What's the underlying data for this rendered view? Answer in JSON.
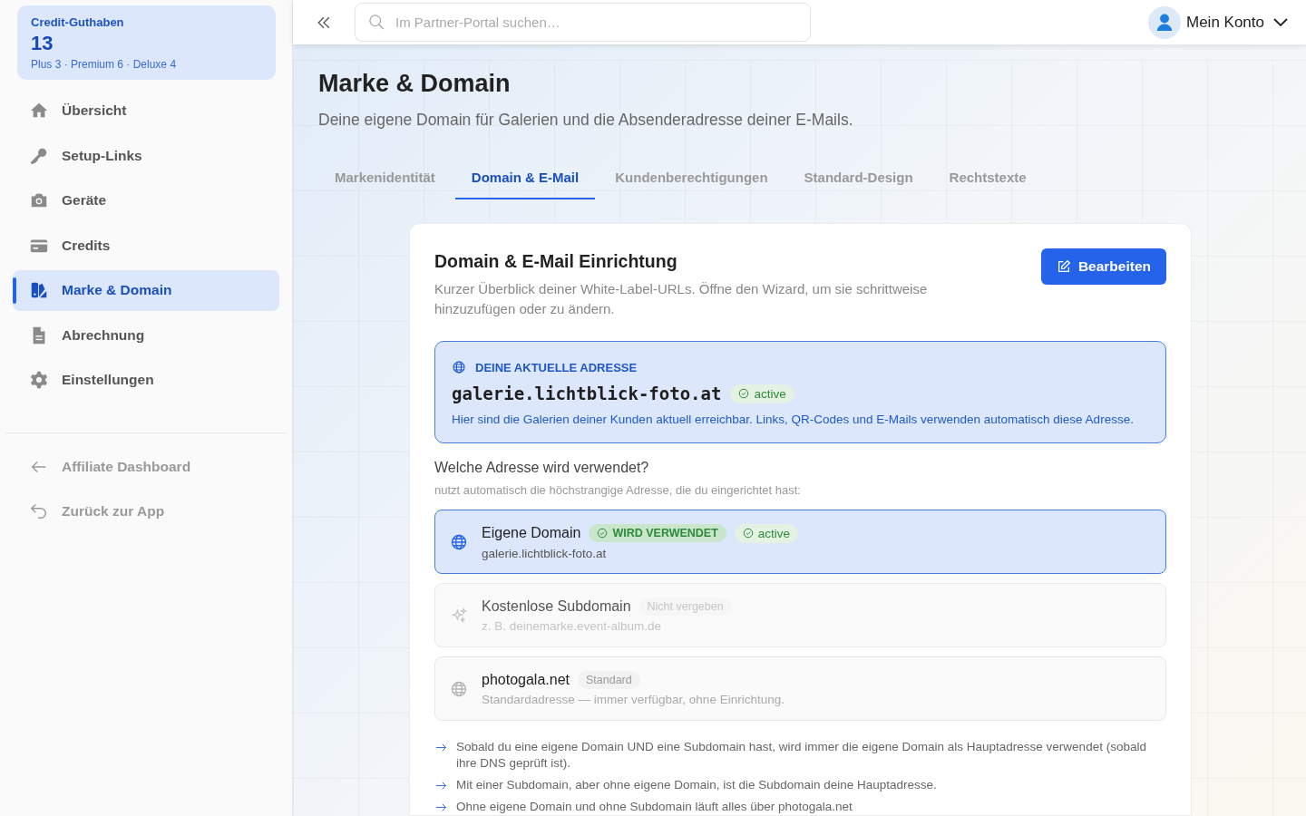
{
  "credit": {
    "label": "Credit-Guthaben",
    "value": "13",
    "breakdown": "Plus 3 · Premium 6 · Deluxe 4"
  },
  "nav": [
    {
      "kind": "home",
      "label": "Übersicht",
      "selected": false
    },
    {
      "kind": "key",
      "label": "Setup-Links",
      "selected": false
    },
    {
      "kind": "camera",
      "label": "Geräte",
      "selected": false
    },
    {
      "kind": "card",
      "label": "Credits",
      "selected": false
    },
    {
      "kind": "brand",
      "label": "Marke & Domain",
      "selected": true
    },
    {
      "kind": "doc",
      "label": "Abrechnung",
      "selected": false
    },
    {
      "kind": "gear",
      "label": "Einstellungen",
      "selected": false
    }
  ],
  "nav_secondary": [
    {
      "kind": "arrow",
      "label": "Affiliate Dashboard"
    },
    {
      "kind": "back",
      "label": "Zurück zur App"
    }
  ],
  "topbar": {
    "search": {
      "placeholder": "Im Partner-Portal suchen…"
    },
    "account": "Mein Konto"
  },
  "page": {
    "title": "Marke & Domain",
    "subtitle": "Deine eigene Domain für Galerien und die Absenderadresse deiner E-Mails."
  },
  "tabs": [
    {
      "label": "Markenidentität",
      "selected": false
    },
    {
      "label": "Domain & E-Mail",
      "selected": true
    },
    {
      "label": "Kundenberechtigungen",
      "selected": false
    },
    {
      "label": "Standard-Design",
      "selected": false
    },
    {
      "label": "Rechtstexte",
      "selected": false
    }
  ],
  "card": {
    "title": "Domain & E-Mail Einrichtung",
    "description": "Kurzer Überblick deiner White-Label-URLs. Öffne den Wizard, um sie schrittweise hinzuzufügen oder zu ändern.",
    "button": "Bearbeiten",
    "current": {
      "label": "DEINE AKTUELLE ADRESSE",
      "address": "galerie.lichtblick-foto.at",
      "status": "active",
      "note": "Hier sind die Galerien deiner Kunden aktuell erreichbar. Links, QR-Codes und E-Mails verwenden automatisch diese Adresse."
    },
    "question": "Welche Adresse wird verwendet?",
    "hint": "nutzt automatisch die höchstrangige Adresse, die du eingerichtet hast:",
    "options": [
      {
        "kind": "globe",
        "name": "Eigene Domain",
        "detail": "galerie.lichtblick-foto.at",
        "selected": true,
        "disabled": false,
        "badges": [
          {
            "kind": "used",
            "text": "WIRD VERWENDET"
          },
          {
            "kind": "active",
            "text": "active"
          }
        ]
      },
      {
        "kind": "sparkle",
        "name": "Kostenlose Subdomain",
        "detail": "z. B. deinemarke.event-album.de",
        "selected": false,
        "disabled": true,
        "badges": [
          {
            "kind": "neutral",
            "text": "Nicht vergeben"
          }
        ]
      },
      {
        "kind": "globe",
        "name": "photogala.net",
        "detail": "Standardadresse — immer verfügbar, ohne Einrichtung.",
        "selected": false,
        "disabled": false,
        "badges": [
          {
            "kind": "neutral",
            "text": "Standard"
          }
        ]
      }
    ],
    "rules": [
      "Sobald du eine eigene Domain UND eine Subdomain hast, wird immer die eigene Domain als Hauptadresse verwendet (sobald ihre DNS geprüft ist).",
      "Mit einer Subdomain, aber ohne eigene Domain, ist die Subdomain deine Hauptadresse.",
      "Ohne eigene Domain und ohne Subdomain läuft alles über photogala.net"
    ]
  }
}
